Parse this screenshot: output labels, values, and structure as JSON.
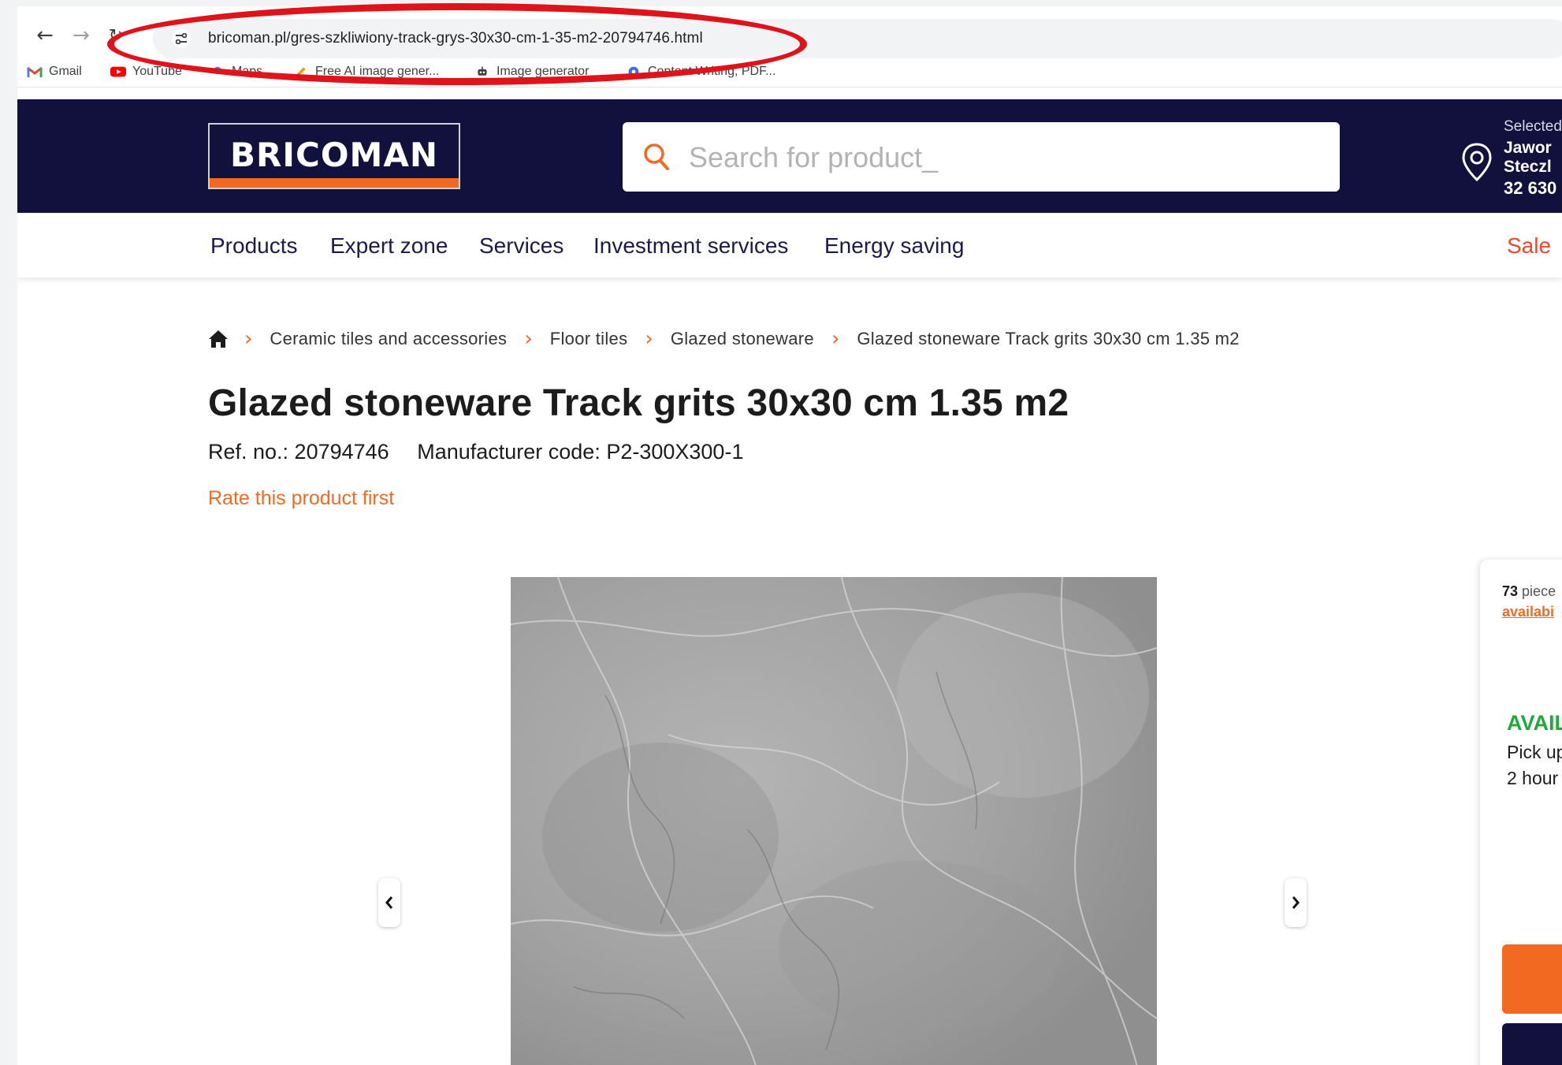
{
  "browser": {
    "url": "bricoman.pl/gres-szkliwiony-track-grys-30x30-cm-1-35-m2-20794746.html",
    "bookmarks": [
      {
        "label": "Gmail",
        "icon": "gmail-icon"
      },
      {
        "label": "YouTube",
        "icon": "youtube-icon"
      },
      {
        "label": "Maps",
        "icon": "maps-icon"
      },
      {
        "label": "Free AI image gener...",
        "icon": "pencil-icon"
      },
      {
        "label": "Image generator",
        "icon": "robot-icon"
      },
      {
        "label": "Content Writing, PDF...",
        "icon": "bookmark-icon"
      }
    ]
  },
  "header": {
    "logo": "BRICOMAN",
    "search_placeholder": "Search for product_",
    "store": {
      "label": "Selected",
      "name_line1": "Jawor",
      "name_line2": "Steczl",
      "zip": "32 630"
    }
  },
  "nav": {
    "items": [
      "Products",
      "Expert zone",
      "Services",
      "Investment services",
      "Energy saving"
    ],
    "sale": "Sale"
  },
  "breadcrumb": [
    "Ceramic tiles and accessories",
    "Floor tiles",
    "Glazed stoneware",
    "Glazed stoneware Track grits 30x30 cm 1.35 m2"
  ],
  "product": {
    "title": "Glazed stoneware Track grits 30x30 cm 1.35 m2",
    "ref": "Ref. no.: 20794746",
    "manufacturer_code": "Manufacturer code: P2-300X300-1",
    "rate_link": "Rate this product first"
  },
  "panel": {
    "stock_count": "73",
    "stock_unit": "piece",
    "availability_link": "availabi",
    "availability_title": "AVAIL",
    "pickup_line1": "Pick up",
    "pickup_line2": "2 hour"
  },
  "colors": {
    "brand_navy": "#12103d",
    "brand_orange": "#f26a21",
    "available_green": "#1faa3a",
    "annotation_red": "#e0131b"
  }
}
